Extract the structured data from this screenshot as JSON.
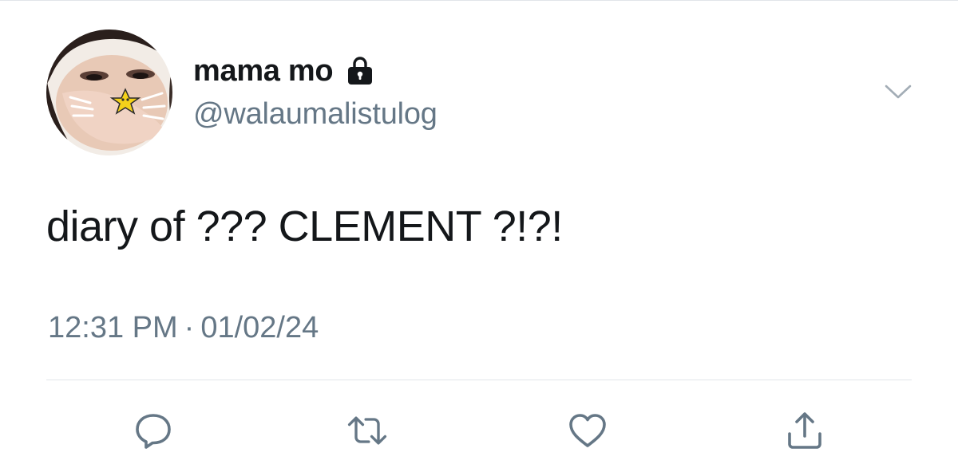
{
  "tweet": {
    "display_name": "mama mo",
    "handle": "@walaumalistulog",
    "text": "diary of ??? CLEMENT ?!?!",
    "time": "12:31 PM",
    "separator": "·",
    "date": "01/02/24",
    "account_protected": true
  },
  "icons": {
    "protected": "lock-icon",
    "menu": "chevron-down-icon",
    "reply": "reply-icon",
    "retweet": "retweet-icon",
    "like": "heart-icon",
    "share": "share-icon"
  },
  "colors": {
    "primary_text": "#14171a",
    "secondary_text": "#657786",
    "divider": "#e1e5e9",
    "action_icon": "#657786"
  }
}
